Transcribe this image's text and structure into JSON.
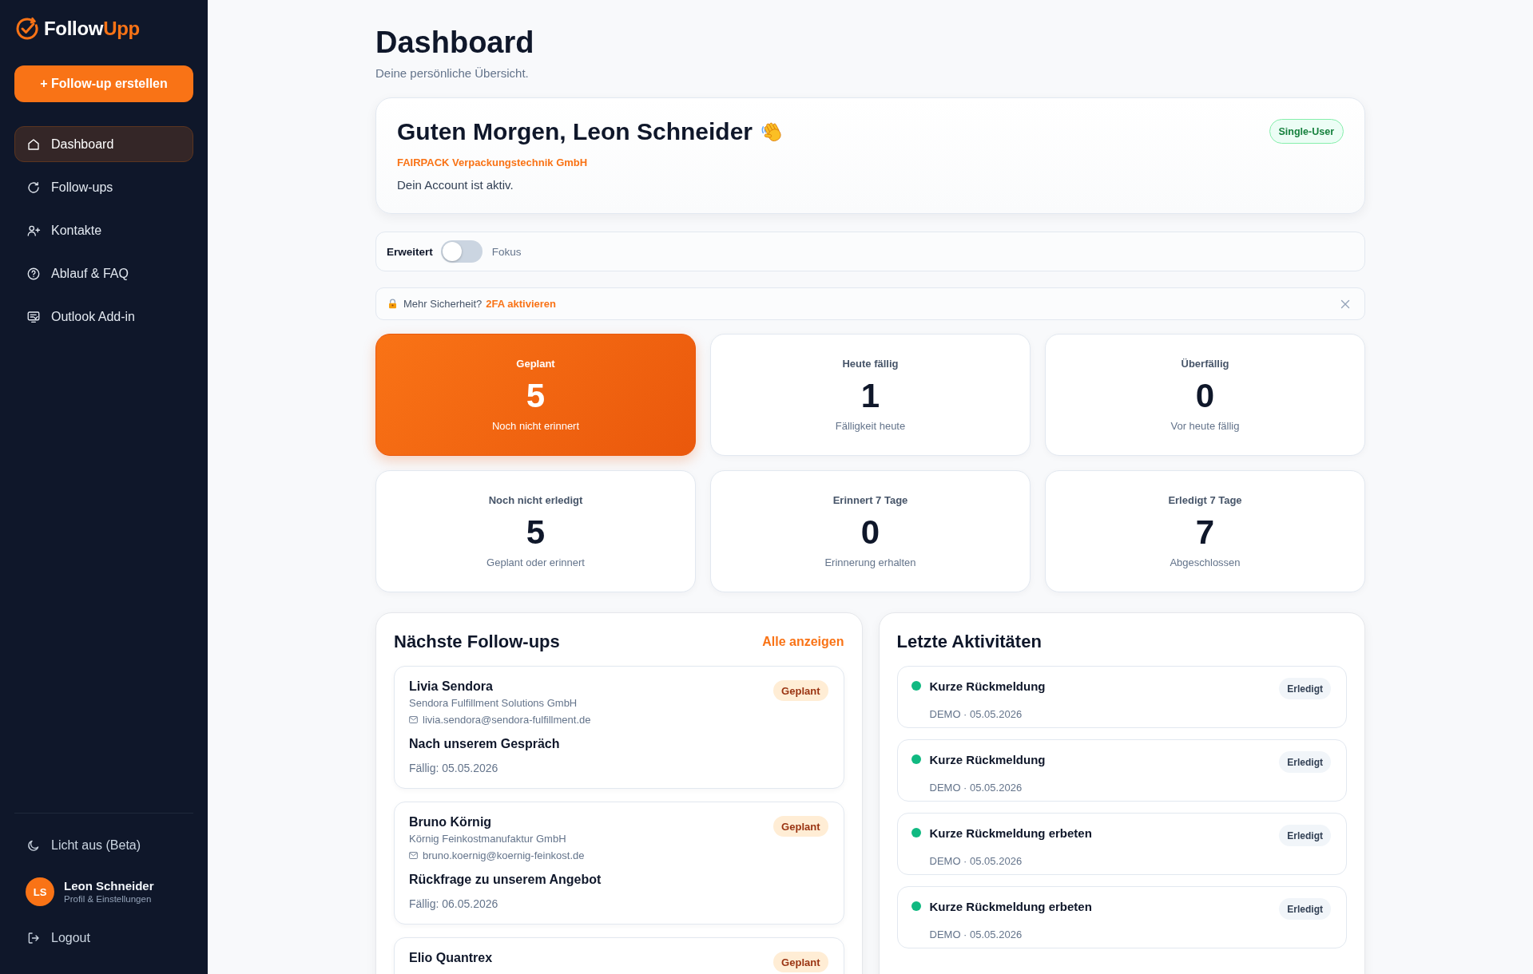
{
  "sidebar": {
    "logo": {
      "text": "Follow",
      "accent": "Upp"
    },
    "create_button": "+ Follow-up erstellen",
    "nav": [
      {
        "label": "Dashboard",
        "selected": true
      },
      {
        "label": "Follow-ups",
        "selected": false
      },
      {
        "label": "Kontakte",
        "selected": false
      },
      {
        "label": "Ablauf & FAQ",
        "selected": false
      },
      {
        "label": "Outlook Add-in",
        "selected": false
      }
    ],
    "theme_toggle": "Licht aus (Beta)",
    "user": {
      "initials": "LS",
      "name": "Leon Schneider",
      "subtitle": "Profil & Einstellungen"
    },
    "logout": "Logout"
  },
  "header": {
    "title": "Dashboard",
    "subtitle": "Deine persönliche Übersicht."
  },
  "welcome": {
    "greeting": "Guten Morgen, Leon Schneider",
    "company": "FAIRPACK Verpackungstechnik GmbH",
    "status": "Dein Account ist aktiv.",
    "plan_badge": "Single-User"
  },
  "view_mode": {
    "left_label": "Erweitert",
    "right_label": "Fokus",
    "on": false
  },
  "security_notice": {
    "text": "Mehr Sicherheit?",
    "link": "2FA aktivieren",
    "dismissible": true
  },
  "stats": [
    {
      "label": "Geplant",
      "value": "5",
      "caption": "Noch nicht erinnert",
      "highlighted": true
    },
    {
      "label": "Heute fällig",
      "value": "1",
      "caption": "Fälligkeit heute",
      "highlighted": false
    },
    {
      "label": "Überfällig",
      "value": "0",
      "caption": "Vor heute fällig",
      "highlighted": false
    },
    {
      "label": "Noch nicht erledigt",
      "value": "5",
      "caption": "Geplant oder erinnert",
      "highlighted": false
    },
    {
      "label": "Erinnert 7 Tage",
      "value": "0",
      "caption": "Erinnerung erhalten",
      "highlighted": false
    },
    {
      "label": "Erledigt 7 Tage",
      "value": "7",
      "caption": "Abgeschlossen",
      "highlighted": false
    }
  ],
  "next_followups": {
    "title": "Nächste Follow-ups",
    "link": "Alle anzeigen",
    "items": [
      {
        "name": "Livia Sendora",
        "company": "Sendora Fulfillment Solutions GmbH",
        "email": "livia.sendora@sendora-fulfillment.de",
        "subject": "Nach unserem Gespräch",
        "due": "Fällig: 05.05.2026",
        "status": "Geplant"
      },
      {
        "name": "Bruno Körnig",
        "company": "Körnig Feinkostmanufaktur GmbH",
        "email": "bruno.koernig@koernig-feinkost.de",
        "subject": "Rückfrage zu unserem Angebot",
        "due": "Fällig: 06.05.2026",
        "status": "Geplant"
      },
      {
        "name": "Elio Quantrex",
        "status": "Geplant"
      }
    ]
  },
  "recent_activities": {
    "title": "Letzte Aktivitäten",
    "items": [
      {
        "title": "Kurze Rückmeldung",
        "meta": "DEMO · 05.05.2026",
        "status": "Erledigt",
        "color": "#10b981"
      },
      {
        "title": "Kurze Rückmeldung",
        "meta": "DEMO · 05.05.2026",
        "status": "Erledigt",
        "color": "#10b981"
      },
      {
        "title": "Kurze Rückmeldung erbeten",
        "meta": "DEMO · 05.05.2026",
        "status": "Erledigt",
        "color": "#10b981"
      },
      {
        "title": "Kurze Rückmeldung erbeten",
        "meta": "DEMO · 05.05.2026",
        "status": "Erledigt",
        "color": "#10b981"
      }
    ]
  }
}
